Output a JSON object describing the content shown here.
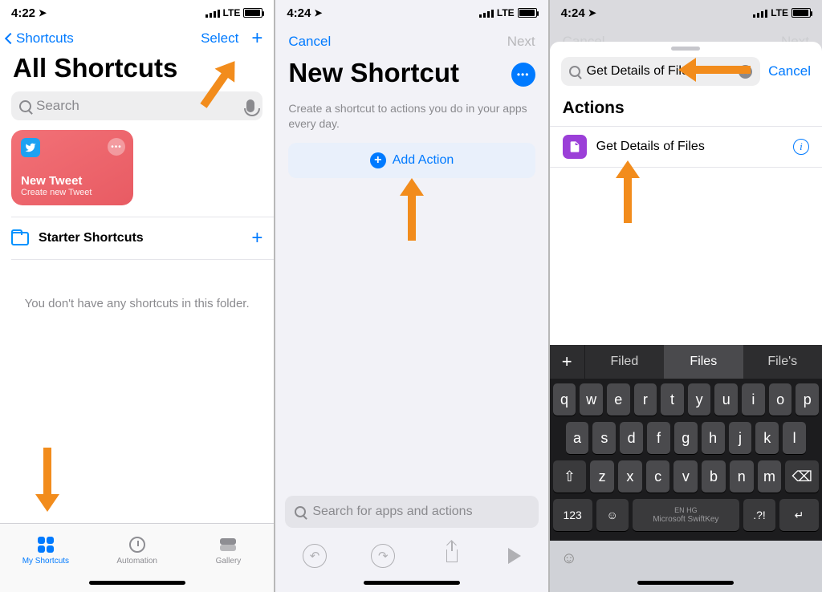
{
  "s1": {
    "time": "4:22",
    "carrier": "LTE",
    "back_label": "Shortcuts",
    "select_label": "Select",
    "title": "All Shortcuts",
    "search_placeholder": "Search",
    "tile": {
      "title": "New Tweet",
      "subtitle": "Create new Tweet"
    },
    "folder_label": "Starter Shortcuts",
    "empty_text": "You don't have any shortcuts in this folder.",
    "tabs": {
      "my": "My Shortcuts",
      "auto": "Automation",
      "gal": "Gallery"
    }
  },
  "s2": {
    "time": "4:24",
    "carrier": "LTE",
    "cancel": "Cancel",
    "next": "Next",
    "title": "New Shortcut",
    "subtitle": "Create a shortcut to actions you do in your apps every day.",
    "add_action": "Add Action",
    "search_placeholder": "Search for apps and actions"
  },
  "s3": {
    "time": "4:24",
    "carrier": "LTE",
    "dim_cancel": "Cancel",
    "dim_next": "Next",
    "search_value": "Get Details of Files",
    "cancel": "Cancel",
    "section": "Actions",
    "result": "Get Details of Files",
    "suggestions": [
      "Filed",
      "Files",
      "File's"
    ],
    "keys_r1": [
      "q",
      "w",
      "e",
      "r",
      "t",
      "y",
      "u",
      "i",
      "o",
      "p"
    ],
    "keys_r2": [
      "a",
      "s",
      "d",
      "f",
      "g",
      "h",
      "j",
      "k",
      "l"
    ],
    "keys_r3": [
      "z",
      "x",
      "c",
      "v",
      "b",
      "n",
      "m"
    ],
    "key_123": "123",
    "space_top": "EN HG",
    "space_bot": "Microsoft SwiftKey",
    "key_punc": ".?!"
  }
}
